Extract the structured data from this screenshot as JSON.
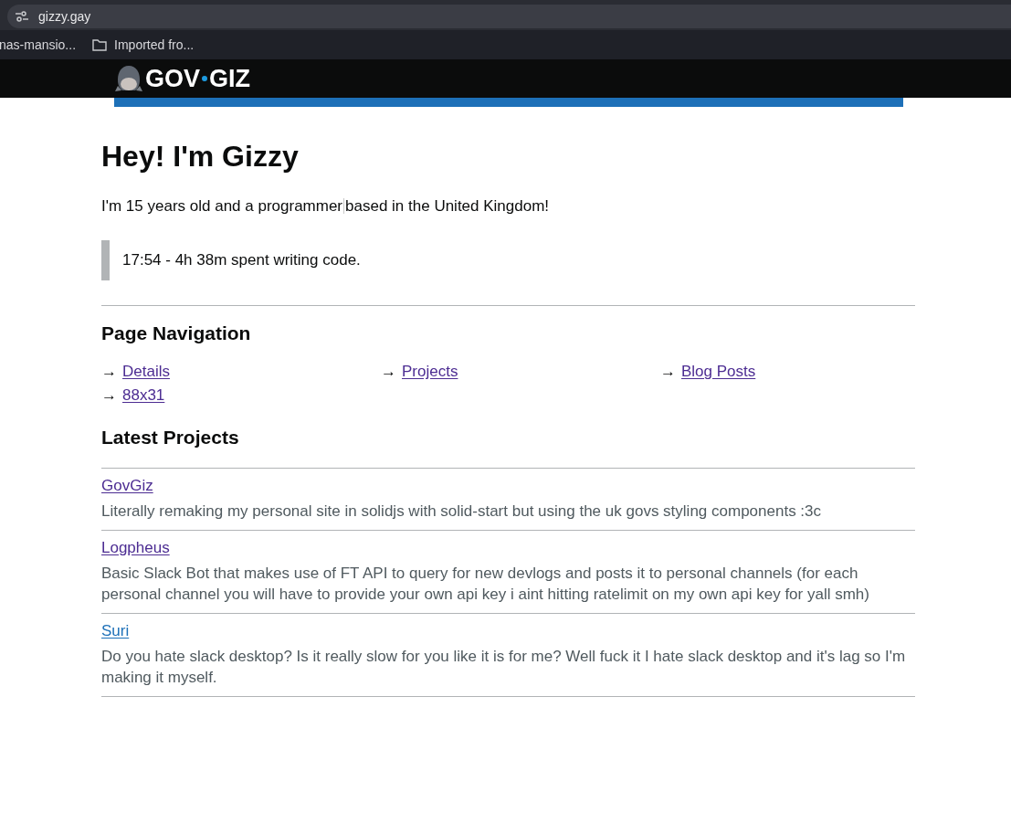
{
  "browser": {
    "url": "gizzy.gay",
    "bookmarks": [
      {
        "label": "nas-mansio...",
        "kind": "page"
      },
      {
        "label": "Imported fro...",
        "kind": "folder"
      }
    ]
  },
  "header": {
    "logo_left": "GOV",
    "logo_right": "GIZ"
  },
  "title": "Hey! I'm Gizzy",
  "intro": {
    "before": "I'm 15 years old and a programmer",
    "after": "based in the United Kingdom!"
  },
  "status_quote": "17:54 - 4h 38m spent writing code.",
  "navigation": {
    "heading": "Page Navigation",
    "links": [
      {
        "arrow": "→",
        "label": "Details",
        "visited": true
      },
      {
        "arrow": "→",
        "label": "Projects",
        "visited": true
      },
      {
        "arrow": "→",
        "label": "Blog Posts",
        "visited": true
      },
      {
        "arrow": "→",
        "label": "88x31",
        "visited": true
      }
    ]
  },
  "projects": {
    "heading": "Latest Projects",
    "items": [
      {
        "name": "GovGiz",
        "visited": true,
        "description": "Literally remaking my personal site in solidjs with solid-start but using the uk govs styling components :3c"
      },
      {
        "name": "Logpheus",
        "visited": true,
        "description": "Basic Slack Bot that makes use of FT API to query for new devlogs and posts it to personal channels (for each personal channel you will have to provide your own api key i aint hitting ratelimit on my own api key for yall smh)"
      },
      {
        "name": "Suri",
        "visited": false,
        "description": "Do you hate slack desktop? Is it really slow for you like it is for me? Well fuck it I hate slack desktop and it's lag so I'm making it myself."
      }
    ]
  }
}
